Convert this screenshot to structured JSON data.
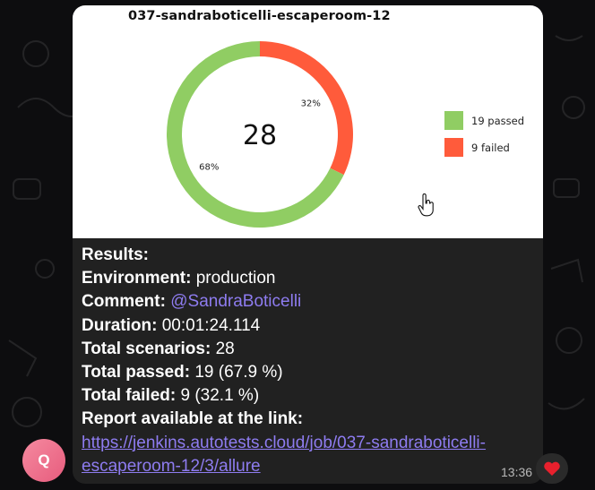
{
  "chart_data": {
    "type": "pie",
    "title": "037-sandraboticelli-escaperoom-12",
    "center_label": "28",
    "slices": [
      {
        "label": "19 passed",
        "value": 19,
        "pct_label": "68%",
        "color": "#90cd63"
      },
      {
        "label": "9 failed",
        "value": 9,
        "pct_label": "32%",
        "color": "#ff5b3b"
      }
    ],
    "legend_position": "right"
  },
  "message": {
    "results_label": "Results:",
    "environment_label": "Environment:",
    "environment_value": "production",
    "comment_label": "Comment:",
    "comment_value": "@SandraBoticelli",
    "duration_label": "Duration:",
    "duration_value": "00:01:24.114",
    "scenarios_label": "Total scenarios:",
    "scenarios_value": "28",
    "passed_label": "Total passed:",
    "passed_value": "19 (67.9 %)",
    "failed_label": "Total failed:",
    "failed_value": "9 (32.1 %)",
    "report_label": "Report available at the link:",
    "link_line1": "https://jenkins.autotests.cloud/job/037-sandraboticelli-",
    "link_line2": "escaperoom-12/3/allure"
  },
  "time": "13:36",
  "avatar_letter": "Q",
  "reaction": "heart-icon",
  "colors": {
    "accent": "#8e7cf0",
    "bubble": "#212121",
    "background": "#0d0d0f"
  }
}
